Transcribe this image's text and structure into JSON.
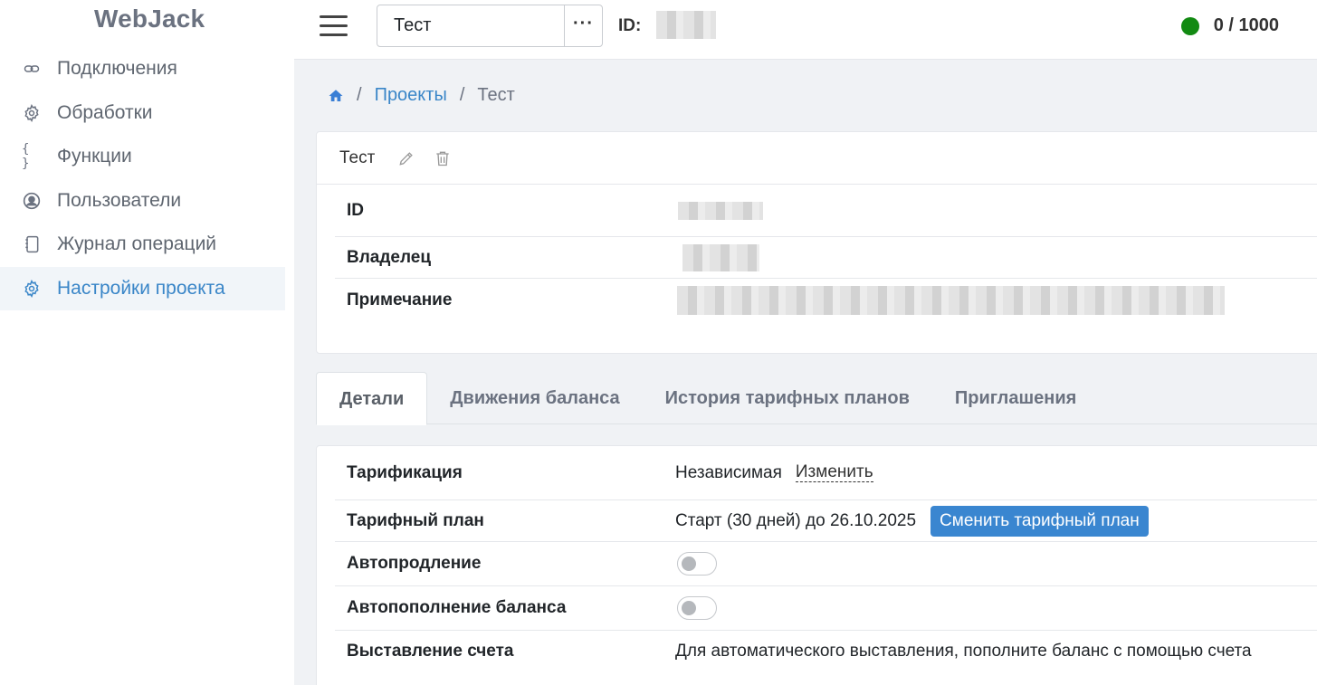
{
  "sidebar": {
    "brand": "WebJack",
    "items": [
      {
        "label": "Подключения",
        "icon": "link-icon"
      },
      {
        "label": "Обработки",
        "icon": "gear-icon"
      },
      {
        "label": "Функции",
        "icon": "braces-icon"
      },
      {
        "label": "Пользователи",
        "icon": "user-circle-icon"
      },
      {
        "label": "Журнал операций",
        "icon": "journal-icon"
      },
      {
        "label": "Настройки проекта",
        "icon": "gear-icon",
        "active": true
      }
    ]
  },
  "topbar": {
    "project_name": "Тест",
    "more_label": "···",
    "id_label": "ID:",
    "balance": "0 / 1000",
    "status_color": "#128a12"
  },
  "breadcrumb": {
    "projects": "Проекты",
    "current": "Тест",
    "sep": "/"
  },
  "project_card": {
    "title": "Тест",
    "rows": [
      {
        "label": "ID"
      },
      {
        "label": "Владелец"
      },
      {
        "label": "Примечание"
      }
    ]
  },
  "tabs": [
    "Детали",
    "Движения баланса",
    "История тарифных планов",
    "Приглашения"
  ],
  "details": {
    "tariffication_label": "Тарификация",
    "tariffication_value": "Независимая",
    "change_link": "Изменить",
    "plan_label": "Тарифный план",
    "plan_value": "Старт (30 дней) до 26.10.2025",
    "change_plan_button": "Сменить тарифный план",
    "autorenew_label": "Автопродление",
    "autorenew_on": false,
    "autotopup_label": "Автопополнение баланса",
    "autotopup_on": false,
    "invoice_label": "Выставление счета",
    "invoice_value": "Для автоматического выставления, пополните баланс с помощью счета"
  },
  "colors": {
    "accent": "#3a86c8",
    "button": "#3a86d0"
  }
}
